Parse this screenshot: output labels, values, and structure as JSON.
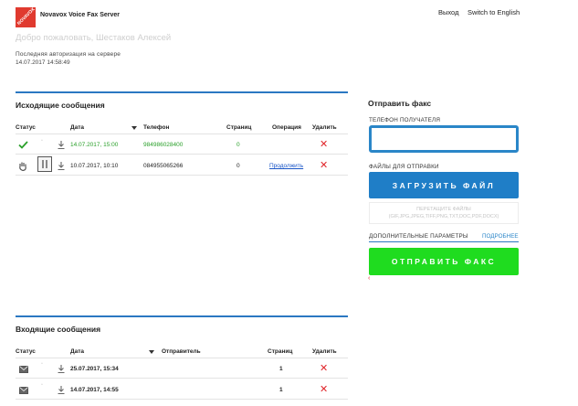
{
  "header": {
    "logo_text": "NOVAVOX",
    "app_name": "Novavox Voice Fax Server",
    "logout": "Выход",
    "switch_lang": "Switch to English",
    "welcome": "Добро пожаловать, Шестаков Алексей",
    "last_login_label": "Последняя авторизация на сервере",
    "last_login_value": "14.07.2017 14:58:49"
  },
  "outgoing": {
    "title": "Исходящие сообщения",
    "columns": {
      "status": "Статус",
      "date": "Дата",
      "phone": "Телефон",
      "pages": "Страниц",
      "operation": "Операция",
      "delete": "Удалить"
    },
    "rows": [
      {
        "status_icon": "check-icon",
        "date": "14.07.2017, 15:00",
        "phone": "984986028400",
        "pages": "0",
        "operation": "",
        "highlight": true
      },
      {
        "status_icon": "hand-icon",
        "date": "10.07.2017, 10:10",
        "phone": "084955065266",
        "pages": "0",
        "operation": "Продолжить",
        "highlight": false
      }
    ]
  },
  "incoming": {
    "title": "Входящие сообщения",
    "columns": {
      "status": "Статус",
      "date": "Дата",
      "sender": "Отправитель",
      "pages": "Страниц",
      "delete": "Удалить"
    },
    "rows": [
      {
        "status_icon": "mail-icon",
        "date": "25.07.2017, 15:34",
        "sender": "",
        "pages": "1"
      },
      {
        "status_icon": "mail-icon",
        "date": "14.07.2017, 14:55",
        "sender": "",
        "pages": "1"
      }
    ]
  },
  "send_fax": {
    "title": "Отправить факс",
    "recipient_label": "ТЕЛЕФОН ПОЛУЧАТЕЛЯ",
    "recipient_value": "",
    "files_label": "ФАЙЛЫ ДЛЯ ОТПРАВКИ",
    "upload_button": "ЗАГРУЗИТЬ ФАЙЛ",
    "drop_hint_line1": "ПЕРЕТАЩИТЕ ФАЙЛЫ",
    "drop_hint_line2": "(GIF,JPG,JPEG,TIFF,PNG,TXT,DOC,PDF,DOCX)",
    "advanced_label": "ДОПОЛНИТЕЛЬНЫЕ ПАРАМЕТРЫ",
    "advanced_more": "ПОДРОБНЕЕ",
    "send_button": "ОТПРАВИТЬ ФАКС"
  },
  "colors": {
    "accent_blue": "#2b78c2",
    "upload_blue": "#1f7ec7",
    "send_green": "#1fdc1f",
    "delete_red": "#e0262b",
    "status_green": "#2aa02a"
  }
}
